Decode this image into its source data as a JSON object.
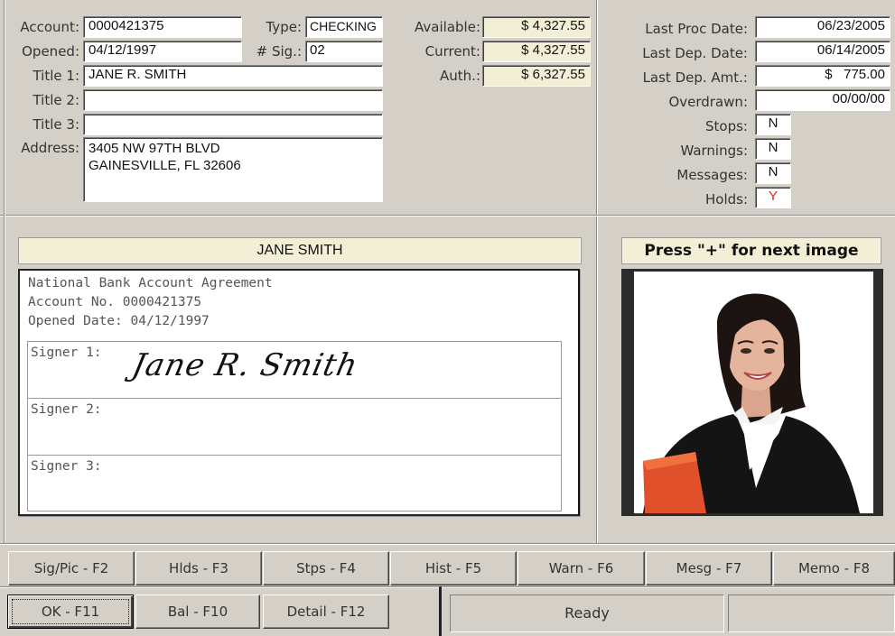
{
  "account": {
    "account_label": "Account:",
    "account_value": "0000421375",
    "type_label": "Type:",
    "type_value": "CHECKING",
    "opened_label": "Opened:",
    "opened_value": "04/12/1997",
    "sig_label": "# Sig.:",
    "sig_value": "02",
    "title1_label": "Title 1:",
    "title1_value": "JANE R. SMITH",
    "title2_label": "Title 2:",
    "title2_value": "",
    "title3_label": "Title 3:",
    "title3_value": "",
    "address_label": "Address:",
    "address_value": "3405 NW 97TH BLVD\nGAINESVILLE, FL 32606"
  },
  "balances": {
    "available_label": "Available:",
    "available_value": "$ 4,327.55",
    "current_label": "Current:",
    "current_value": "$ 4,327.55",
    "auth_label": "Auth.:",
    "auth_value": "$ 6,327.55"
  },
  "status_info": {
    "last_proc_label": "Last Proc Date:",
    "last_proc_value": "06/23/2005",
    "last_dep_label": "Last Dep. Date:",
    "last_dep_value": "06/14/2005",
    "last_dep_amt_label": "Last Dep. Amt.:",
    "last_dep_amt_value": "$   775.00",
    "overdrawn_label": "Overdrawn:",
    "overdrawn_value": "00/00/00",
    "stops_label": "Stops:",
    "stops_value": "N",
    "warnings_label": "Warnings:",
    "warnings_value": "N",
    "messages_label": "Messages:",
    "messages_value": "N",
    "holds_label": "Holds:",
    "holds_value": "Y"
  },
  "signature_card": {
    "banner": "JANE SMITH",
    "doc_line1": "National Bank Account Agreement",
    "doc_line2": "Account No. 0000421375",
    "doc_line3": "Opened Date: 04/12/1997",
    "signer1_label": "Signer 1:",
    "signer1_signature": "Jane R. Smith",
    "signer2_label": "Signer 2:",
    "signer3_label": "Signer 3:"
  },
  "photo_panel": {
    "banner": "Press \"+\" for next image"
  },
  "function_keys": [
    "Sig/Pic - F2",
    "Hlds - F3",
    "Stps - F4",
    "Hist - F5",
    "Warn - F6",
    "Mesg - F7",
    "Memo - F8"
  ],
  "bottom_buttons": {
    "ok": "OK - F11",
    "bal": "Bal - F10",
    "detail": "Detail - F12"
  },
  "status_bar": {
    "status": "Ready"
  },
  "colors": {
    "window_bg": "#d4d0c8",
    "money_bg": "#f3efd6",
    "holds_flag": "#e02020"
  }
}
